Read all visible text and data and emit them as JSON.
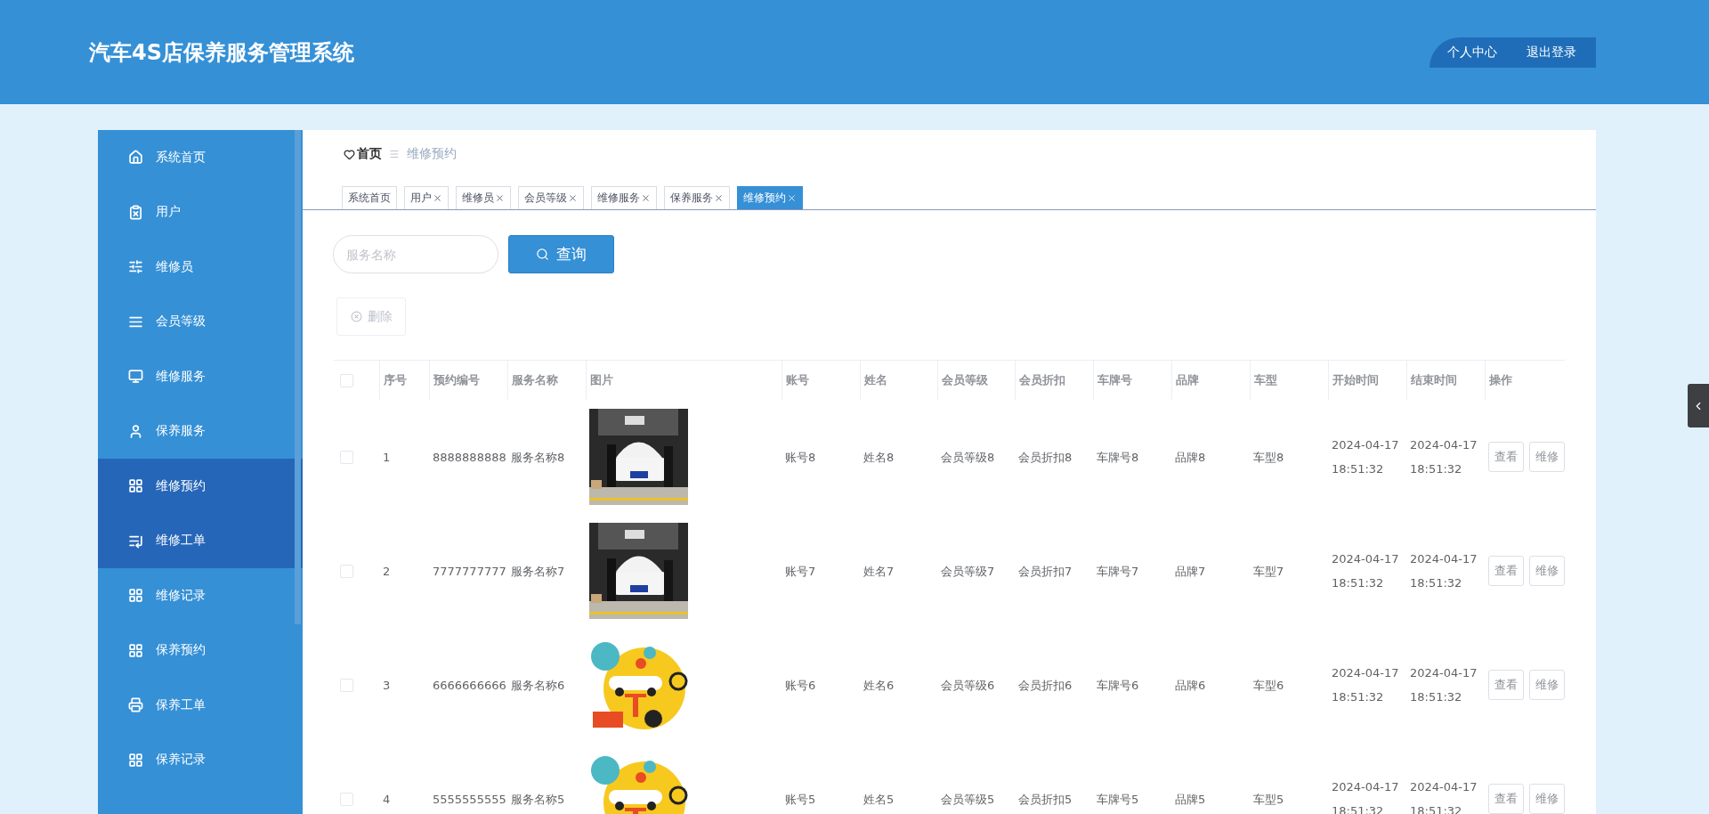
{
  "header": {
    "title": "汽车4S店保养服务管理系统",
    "user_menu": [
      "个人中心",
      "退出登录"
    ]
  },
  "sidebar": {
    "items": [
      {
        "label": "系统首页",
        "selected": false
      },
      {
        "label": "用户",
        "selected": false
      },
      {
        "label": "维修员",
        "selected": false
      },
      {
        "label": "会员等级",
        "selected": false
      },
      {
        "label": "维修服务",
        "selected": false
      },
      {
        "label": "保养服务",
        "selected": false
      },
      {
        "label": "维修预约",
        "selected": true
      },
      {
        "label": "维修工单",
        "selected": true
      },
      {
        "label": "维修记录",
        "selected": false
      },
      {
        "label": "保养预约",
        "selected": false
      },
      {
        "label": "保养工单",
        "selected": false
      },
      {
        "label": "保养记录",
        "selected": false
      }
    ]
  },
  "breadcrumb": [
    "首页",
    "维修预约"
  ],
  "tabs": [
    {
      "label": "系统首页",
      "selected": false,
      "closable": false
    },
    {
      "label": "用户",
      "selected": false,
      "closable": true
    },
    {
      "label": "维修员",
      "selected": false,
      "closable": true
    },
    {
      "label": "会员等级",
      "selected": false,
      "closable": true
    },
    {
      "label": "维修服务",
      "selected": false,
      "closable": true
    },
    {
      "label": "保养服务",
      "selected": false,
      "closable": true
    },
    {
      "label": "维修预约",
      "selected": true,
      "closable": true
    }
  ],
  "search": {
    "placeholder": "服务名称",
    "button": "查询"
  },
  "delete_button": "删除",
  "table": {
    "header_checked": false,
    "columns": [
      "序号",
      "预约编号",
      "服务名称",
      "图片",
      "账号",
      "姓名",
      "会员等级",
      "会员折扣",
      "车牌号",
      "品牌",
      "车型",
      "开始时间",
      "结束时间",
      "操作"
    ],
    "rows": [
      {
        "checked": false,
        "cells": [
          "1",
          "8888888888",
          "服务名称8",
          {
            "kind": "picture"
          },
          "账号8",
          "姓名8",
          "会员等级8",
          "会员折扣8",
          "车牌号8",
          "品牌8",
          "车型8",
          [
            "2024-04-17",
            "18:51:32"
          ],
          [
            "2024-04-17",
            "18:51:32"
          ]
        ],
        "actions": [
          "查看",
          "维修"
        ]
      },
      {
        "checked": false,
        "cells": [
          "2",
          "7777777777",
          "服务名称7",
          {
            "kind": "picture"
          },
          "账号7",
          "姓名7",
          "会员等级7",
          "会员折扣7",
          "车牌号7",
          "品牌7",
          "车型7",
          [
            "2024-04-17",
            "18:51:32"
          ],
          [
            "2024-04-17",
            "18:51:32"
          ]
        ],
        "actions": [
          "查看",
          "维修"
        ]
      },
      {
        "checked": false,
        "cells": [
          "3",
          "6666666666",
          "服务名称6",
          {
            "kind": "picture"
          },
          "账号6",
          "姓名6",
          "会员等级6",
          "会员折扣6",
          "车牌号6",
          "品牌6",
          "车型6",
          [
            "2024-04-17",
            "18:51:32"
          ],
          [
            "2024-04-17",
            "18:51:32"
          ]
        ],
        "actions": [
          "查看",
          "维修"
        ]
      },
      {
        "checked": false,
        "cells": [
          "4",
          "5555555555",
          "服务名称5",
          {
            "kind": "picture"
          },
          "账号5",
          "姓名5",
          "会员等级5",
          "会员折扣5",
          "车牌号5",
          "品牌5",
          "车型5",
          [
            "2024-04-17",
            "18:51:32"
          ],
          [
            "2024-04-17",
            "18:51:32"
          ]
        ],
        "actions": [
          "查看",
          "维修"
        ]
      }
    ]
  }
}
